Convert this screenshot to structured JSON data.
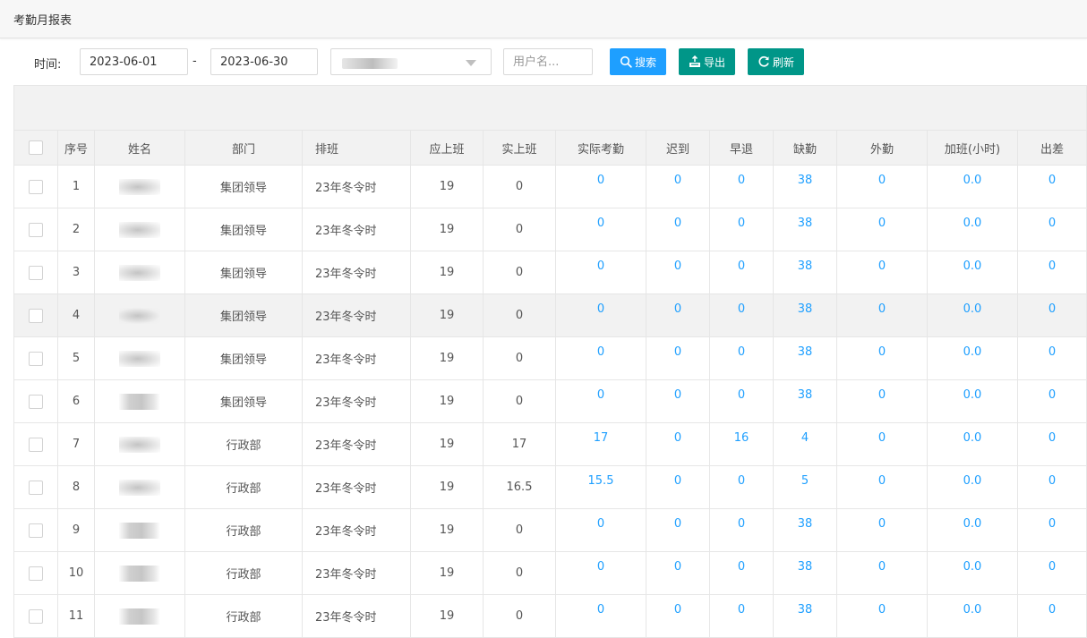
{
  "page": {
    "title": "考勤月报表"
  },
  "filters": {
    "time_label": "时间:",
    "start_date": "2023-06-01",
    "separator": "-",
    "end_date": "2023-06-30",
    "dept_select_value": "",
    "username_placeholder": "用户名..."
  },
  "buttons": {
    "search": "搜索",
    "export": "导出",
    "refresh": "刷新"
  },
  "colors": {
    "primary_blue": "#1e9fff",
    "teal": "#009688",
    "link_blue": "#1e9fff"
  },
  "table": {
    "columns": [
      "序号",
      "姓名",
      "部门",
      "排班",
      "应上班",
      "实上班",
      "实际考勤",
      "迟到",
      "早退",
      "缺勤",
      "外勤",
      "加班(小时)",
      "出差"
    ],
    "highlighted_row_index": 3,
    "rows": [
      {
        "no": "1",
        "dept": "集团领导",
        "shift": "23年冬令时",
        "due": "19",
        "actual": "0",
        "att": "0",
        "late": "0",
        "early": "0",
        "absent": "38",
        "field": "0",
        "ot": "0.0",
        "trip": "0"
      },
      {
        "no": "2",
        "dept": "集团领导",
        "shift": "23年冬令时",
        "due": "19",
        "actual": "0",
        "att": "0",
        "late": "0",
        "early": "0",
        "absent": "38",
        "field": "0",
        "ot": "0.0",
        "trip": "0"
      },
      {
        "no": "3",
        "dept": "集团领导",
        "shift": "23年冬令时",
        "due": "19",
        "actual": "0",
        "att": "0",
        "late": "0",
        "early": "0",
        "absent": "38",
        "field": "0",
        "ot": "0.0",
        "trip": "0"
      },
      {
        "no": "4",
        "dept": "集团领导",
        "shift": "23年冬令时",
        "due": "19",
        "actual": "0",
        "att": "0",
        "late": "0",
        "early": "0",
        "absent": "38",
        "field": "0",
        "ot": "0.0",
        "trip": "0"
      },
      {
        "no": "5",
        "dept": "集团领导",
        "shift": "23年冬令时",
        "due": "19",
        "actual": "0",
        "att": "0",
        "late": "0",
        "early": "0",
        "absent": "38",
        "field": "0",
        "ot": "0.0",
        "trip": "0"
      },
      {
        "no": "6",
        "dept": "集团领导",
        "shift": "23年冬令时",
        "due": "19",
        "actual": "0",
        "att": "0",
        "late": "0",
        "early": "0",
        "absent": "38",
        "field": "0",
        "ot": "0.0",
        "trip": "0"
      },
      {
        "no": "7",
        "dept": "行政部",
        "shift": "23年冬令时",
        "due": "19",
        "actual": "17",
        "att": "17",
        "late": "0",
        "early": "16",
        "absent": "4",
        "field": "0",
        "ot": "0.0",
        "trip": "0"
      },
      {
        "no": "8",
        "dept": "行政部",
        "shift": "23年冬令时",
        "due": "19",
        "actual": "16.5",
        "att": "15.5",
        "late": "0",
        "early": "0",
        "absent": "5",
        "field": "0",
        "ot": "0.0",
        "trip": "0"
      },
      {
        "no": "9",
        "dept": "行政部",
        "shift": "23年冬令时",
        "due": "19",
        "actual": "0",
        "att": "0",
        "late": "0",
        "early": "0",
        "absent": "38",
        "field": "0",
        "ot": "0.0",
        "trip": "0"
      },
      {
        "no": "10",
        "dept": "行政部",
        "shift": "23年冬令时",
        "due": "19",
        "actual": "0",
        "att": "0",
        "late": "0",
        "early": "0",
        "absent": "38",
        "field": "0",
        "ot": "0.0",
        "trip": "0"
      },
      {
        "no": "11",
        "dept": "行政部",
        "shift": "23年冬令时",
        "due": "19",
        "actual": "0",
        "att": "0",
        "late": "0",
        "early": "0",
        "absent": "38",
        "field": "0",
        "ot": "0.0",
        "trip": "0"
      }
    ]
  }
}
